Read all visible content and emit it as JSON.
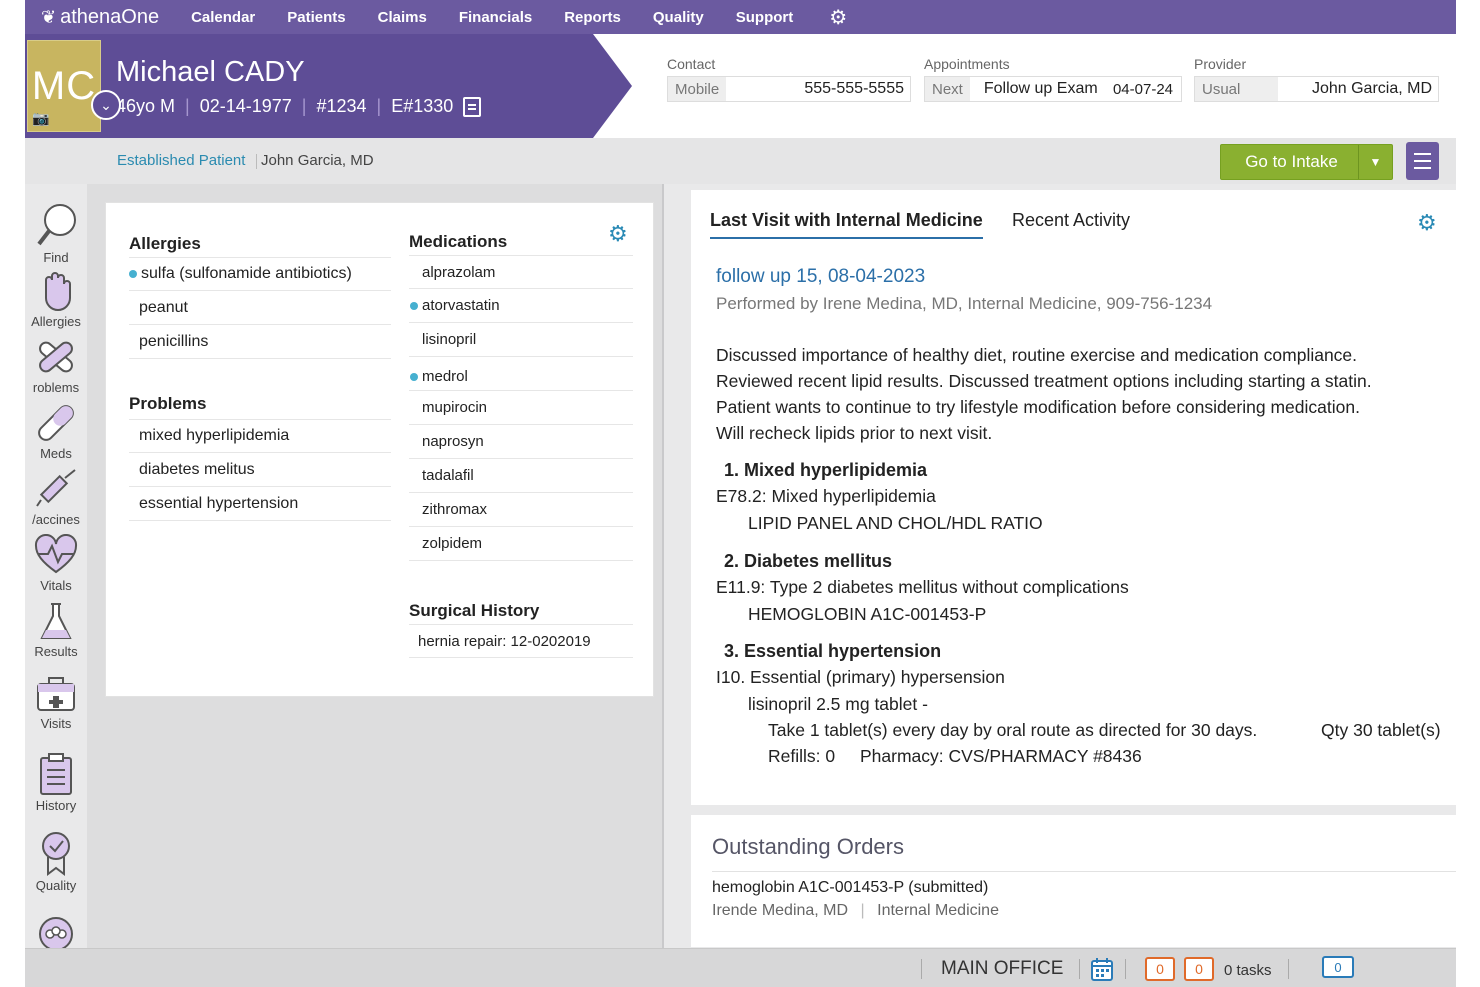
{
  "nav": {
    "logo": "athenaOne",
    "items": [
      "Calendar",
      "Patients",
      "Claims",
      "Financials",
      "Reports",
      "Quality",
      "Support"
    ]
  },
  "patient": {
    "initials": "MC",
    "name": "Michael CADY",
    "age_sex": "46yo M",
    "dob": "02-14-1977",
    "id": "#1234",
    "enc": "E#1330"
  },
  "contact": {
    "label": "Contact",
    "key": "Mobile",
    "value": "555-555-5555"
  },
  "appointments": {
    "label": "Appointments",
    "key": "Next",
    "value": "Follow up Exam",
    "date": "04-07-24"
  },
  "provider": {
    "label": "Provider",
    "key": "Usual",
    "value": "John Garcia, MD"
  },
  "subheader": {
    "status": "Established Patient",
    "provider": "John Garcia, MD",
    "intake_label": "Go to Intake"
  },
  "sidebar": [
    "Find",
    "Allergies",
    "roblems",
    "Meds",
    "/accines",
    "Vitals",
    "Results",
    "Visits",
    "History",
    "Quality"
  ],
  "allergies": {
    "title": "Allergies",
    "items": [
      {
        "name": "sulfa (sulfonamide antibiotics)",
        "flag": true
      },
      {
        "name": "peanut",
        "flag": false
      },
      {
        "name": "penicillins",
        "flag": false
      }
    ]
  },
  "problems": {
    "title": "Problems",
    "items": [
      "mixed hyperlipidemia",
      "diabetes melitus",
      "essential hypertension"
    ]
  },
  "medications": {
    "title": "Medications",
    "items": [
      {
        "name": "alprazolam",
        "flag": false
      },
      {
        "name": "atorvastatin",
        "flag": true
      },
      {
        "name": "lisinopril",
        "flag": false
      },
      {
        "name": "medrol",
        "flag": true
      },
      {
        "name": "mupirocin",
        "flag": false
      },
      {
        "name": "naprosyn",
        "flag": false
      },
      {
        "name": "tadalafil",
        "flag": false
      },
      {
        "name": "zithromax",
        "flag": false
      },
      {
        "name": "zolpidem",
        "flag": false
      }
    ]
  },
  "surgical": {
    "title": "Surgical History",
    "item": "hernia repair: 12-0202019"
  },
  "visit": {
    "tab_active": "Last Visit with Internal Medicine",
    "tab_other": "Recent Activity",
    "title": "follow up 15, 08-04-2023",
    "performed_by": "Performed by Irene Medina, MD, Internal Medicine, 909-756-1234",
    "note": [
      "Discussed importance of healthy diet, routine exercise and medication compliance.",
      "Reviewed recent lipid results.  Discussed treatment options including starting a statin.",
      "Patient wants to continue to try lifestyle modification before considering medication.",
      "Will recheck lipids prior to next visit."
    ],
    "dx1": {
      "head": "1.  Mixed hyperlipidemia",
      "code": "E78.2: Mixed hyperlipidemia",
      "order": "LIPID PANEL AND CHOL/HDL RATIO"
    },
    "dx2": {
      "head": "2.  Diabetes mellitus",
      "code": "E11.9: Type 2 diabetes mellitus without complications",
      "order": "HEMOGLOBIN A1C-001453-P"
    },
    "dx3": {
      "head": "3.  Essential hypertension",
      "code": "I10. Essential (primary) hypersension",
      "med": "lisinopril 2.5 mg tablet -",
      "sig": "Take 1 tablet(s) every day by oral route as directed for 30 days.",
      "qty": "Qty 30 tablet(s)",
      "refills": "Refills: 0",
      "pharmacy": "Pharmacy: CVS/PHARMACY #8436"
    }
  },
  "orders": {
    "title": "Outstanding Orders",
    "item": "hemoglobin  A1C-001453-P (submitted)",
    "provider": "Irende Medina, MD",
    "dept": "Internal Medicine"
  },
  "footer": {
    "office": "MAIN OFFICE",
    "count1": "0",
    "count2": "0",
    "tasks": "0 tasks",
    "chat": "0"
  },
  "colors": {
    "purple": "#6b5aa0",
    "header_purple": "#5e4d96",
    "accent_blue": "#2b6fa8",
    "green": "#8ab030",
    "avatar_gold": "#c8b560"
  }
}
